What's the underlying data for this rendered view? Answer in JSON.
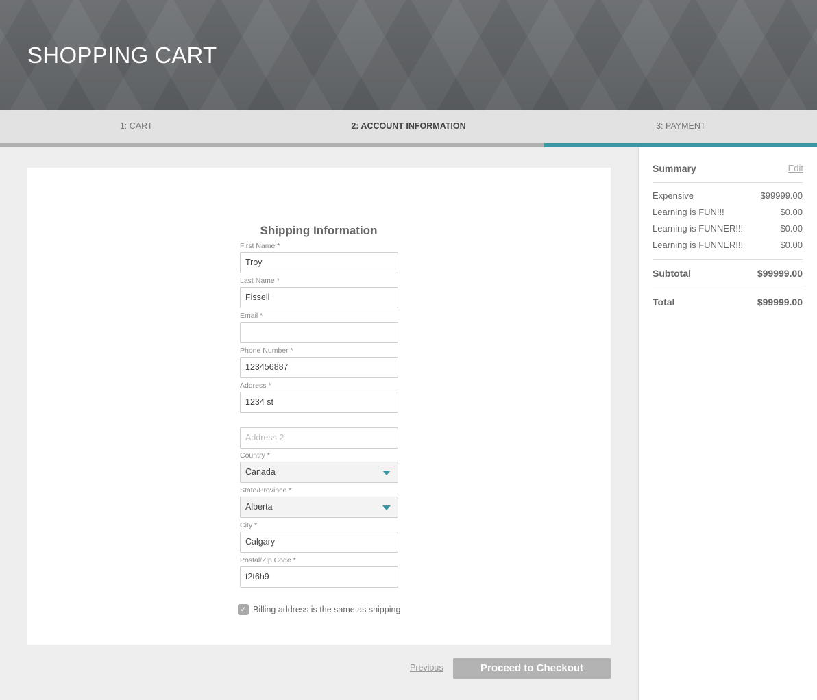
{
  "header": {
    "title": "SHOPPING CART"
  },
  "steps": [
    {
      "label": "1: CART"
    },
    {
      "label": "2: ACCOUNT INFORMATION"
    },
    {
      "label": "3: PAYMENT"
    }
  ],
  "progress_fraction": 0.67,
  "form": {
    "title": "Shipping Information",
    "first_name": {
      "label": "First Name *",
      "value": "Troy"
    },
    "last_name": {
      "label": "Last Name *",
      "value": "Fissell"
    },
    "email": {
      "label": "Email *",
      "value": ""
    },
    "phone": {
      "label": "Phone Number *",
      "value": "123456887"
    },
    "address": {
      "label": "Address *",
      "value": "1234 st"
    },
    "address2": {
      "placeholder": "Address 2",
      "value": ""
    },
    "country": {
      "label": "Country *",
      "value": "Canada"
    },
    "state": {
      "label": "State/Province *",
      "value": "Alberta"
    },
    "city": {
      "label": "City *",
      "value": "Calgary"
    },
    "postal": {
      "label": "Postal/Zip Code *",
      "value": "t2t6h9"
    },
    "billing_same": {
      "label": "Billing address is the same as shipping",
      "checked": true,
      "check_glyph": "✓"
    }
  },
  "footer": {
    "previous_label": "Previous",
    "checkout_label": "Proceed to Checkout"
  },
  "summary": {
    "title": "Summary",
    "edit_label": "Edit",
    "items": [
      {
        "name": "Expensive",
        "price": "$99999.00"
      },
      {
        "name": "Learning is FUN!!!",
        "price": "$0.00"
      },
      {
        "name": "Learning is FUNNER!!!",
        "price": "$0.00"
      },
      {
        "name": "Learning is FUNNER!!!",
        "price": "$0.00"
      }
    ],
    "subtotal_label": "Subtotal",
    "subtotal_value": "$99999.00",
    "total_label": "Total",
    "total_value": "$99999.00"
  },
  "colors": {
    "accent": "#3c96a2",
    "header_bg": "#65686b",
    "button_disabled": "#b3b3b3"
  }
}
